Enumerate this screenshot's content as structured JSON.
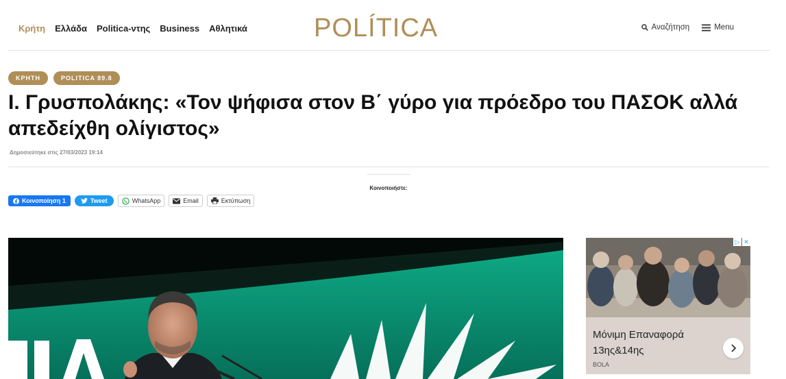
{
  "header": {
    "nav": [
      {
        "label": "Κρήτη",
        "active": true
      },
      {
        "label": "Ελλάδα",
        "active": false
      },
      {
        "label": "Politica-ντης",
        "active": false
      },
      {
        "label": "Business",
        "active": false
      },
      {
        "label": "Αθλητικά",
        "active": false
      }
    ],
    "logo": "POLÍTICA",
    "search_label": "Αναζήτηση",
    "menu_label": "Menu"
  },
  "article": {
    "tags": [
      "ΚΡΗΤΗ",
      "POLITICA 89.8"
    ],
    "title": "Ι. Γρυσπολάκης: «Τον ψήφισα στον Β΄ γύρο για πρόεδρο του ΠΑΣΟΚ αλλά απεδείχθη ολίγιστος»",
    "published": "Δημοσιεύτηκε στις 27/03/2023 19:14"
  },
  "share": {
    "label": "Κοινοποιήστε:",
    "facebook": "Κοινοποίηση 1",
    "twitter": "Tweet",
    "whatsapp": "WhatsApp",
    "email": "Email",
    "print": "Εκτύπωση"
  },
  "ad": {
    "text": "Μόνιμη Επαναφορά 13ης&14ης",
    "brand": "BOLA"
  },
  "colors": {
    "accent": "#b08e57",
    "facebook": "#1877f2",
    "twitter": "#1d9bf0"
  }
}
